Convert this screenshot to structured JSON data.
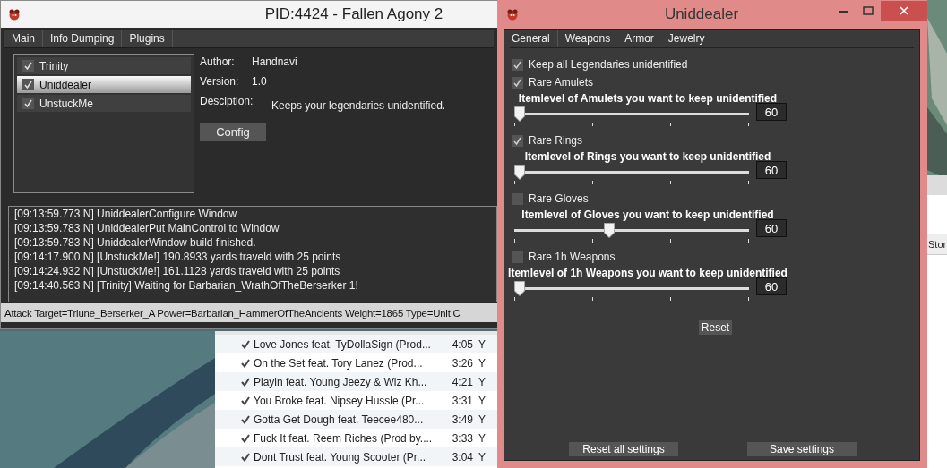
{
  "main_window": {
    "title": "PID:4424 - Fallen Agony 2",
    "tabs": [
      "Main",
      "Info Dumping",
      "Plugins"
    ],
    "plugins": [
      {
        "name": "Trinity",
        "checked": true,
        "selected": false
      },
      {
        "name": "Uniddealer",
        "checked": true,
        "selected": true
      },
      {
        "name": "UnstuckMe",
        "checked": true,
        "selected": false
      }
    ],
    "details": [
      {
        "label": "Author:",
        "value": "Handnavi"
      },
      {
        "label": "Version:",
        "value": "1.0"
      },
      {
        "label": "Desciption:",
        "value": "Keeps your legendaries unidentified."
      }
    ],
    "config_button": "Config",
    "log": [
      "[09:13:59.773 N] UniddealerConfigure Window",
      "[09:13:59.783 N] UniddealerPut MainControl to Window",
      "[09:13:59.783 N] UniddealerWindow build finished.",
      "[09:14:17.900 N] [UnstuckMe!] 190.8933 yards traveld with 25 points",
      "[09:14:24.932 N] [UnstuckMe!] 161.1128 yards traveld with 25 points",
      "[09:14:40.563 N] [Trinity] Waiting for Barbarian_WrathOfTheBerserker 1!"
    ],
    "status_bar": "Attack Target=Triune_Berserker_A Power=Barbarian_HammerOfTheAncients Weight=1865 Type=Unit C"
  },
  "playlist": [
    {
      "checked": true,
      "title": "Love Jones feat. TyDollaSign (Prod...",
      "time": "4:05",
      "column_3": "Y"
    },
    {
      "checked": true,
      "title": "On the Set feat. Tory Lanez (Prod...",
      "time": "3:26",
      "column_3": "Y"
    },
    {
      "checked": true,
      "title": "Playin feat. Young Jeezy & Wiz Kh...",
      "time": "4:21",
      "column_3": "Y"
    },
    {
      "checked": true,
      "title": "You Broke feat. Nipsey Hussle (Pr...",
      "time": "3:31",
      "column_3": "Y"
    },
    {
      "checked": true,
      "title": "Gotta Get Dough feat. Teecee480...",
      "time": "3:49",
      "column_3": "Y"
    },
    {
      "checked": true,
      "title": "Fuck It feat. Reem Riches (Prod by....",
      "time": "3:33",
      "column_3": "Y"
    },
    {
      "checked": true,
      "title": "Dont Trust feat. Young Scooter (Pr...",
      "time": "3:04",
      "column_3": "Y"
    }
  ],
  "back_window": {
    "text": "Stor"
  },
  "uniddealer": {
    "title": "Uniddealer",
    "tabs": [
      {
        "label": "General",
        "selected": true
      },
      {
        "label": "Weapons",
        "selected": false
      },
      {
        "label": "Armor",
        "selected": false
      },
      {
        "label": "Jewelry",
        "selected": false
      }
    ],
    "options": [
      {
        "kind": "checkbox",
        "label": "Keep all Legendaries unidentified",
        "checked": true
      },
      {
        "kind": "checkbox",
        "label": "Rare Amulets",
        "checked": true
      },
      {
        "kind": "slider",
        "label": "Itemlevel of Amulets you want to keep unidentified",
        "level": 0,
        "value": "60"
      },
      {
        "kind": "checkbox",
        "label": "Rare Rings",
        "checked": true
      },
      {
        "kind": "slider",
        "label": "Itemlevel of Rings you want to keep unidentified",
        "level": 0,
        "value": "60"
      },
      {
        "kind": "checkbox",
        "label": "Rare Gloves",
        "checked": false
      },
      {
        "kind": "slider",
        "label": "Itemlevel of Gloves you want to keep unidentified",
        "level": 0.4,
        "value": "60"
      },
      {
        "kind": "checkbox",
        "label": "Rare 1h Weapons",
        "checked": false
      },
      {
        "kind": "slider",
        "label": "Itemlevel of 1h Weapons you want to keep unidentified",
        "level": 0,
        "value": "60"
      }
    ],
    "reset_button": "Reset",
    "footer_buttons": [
      "Reset all settings",
      "Save settings"
    ]
  }
}
